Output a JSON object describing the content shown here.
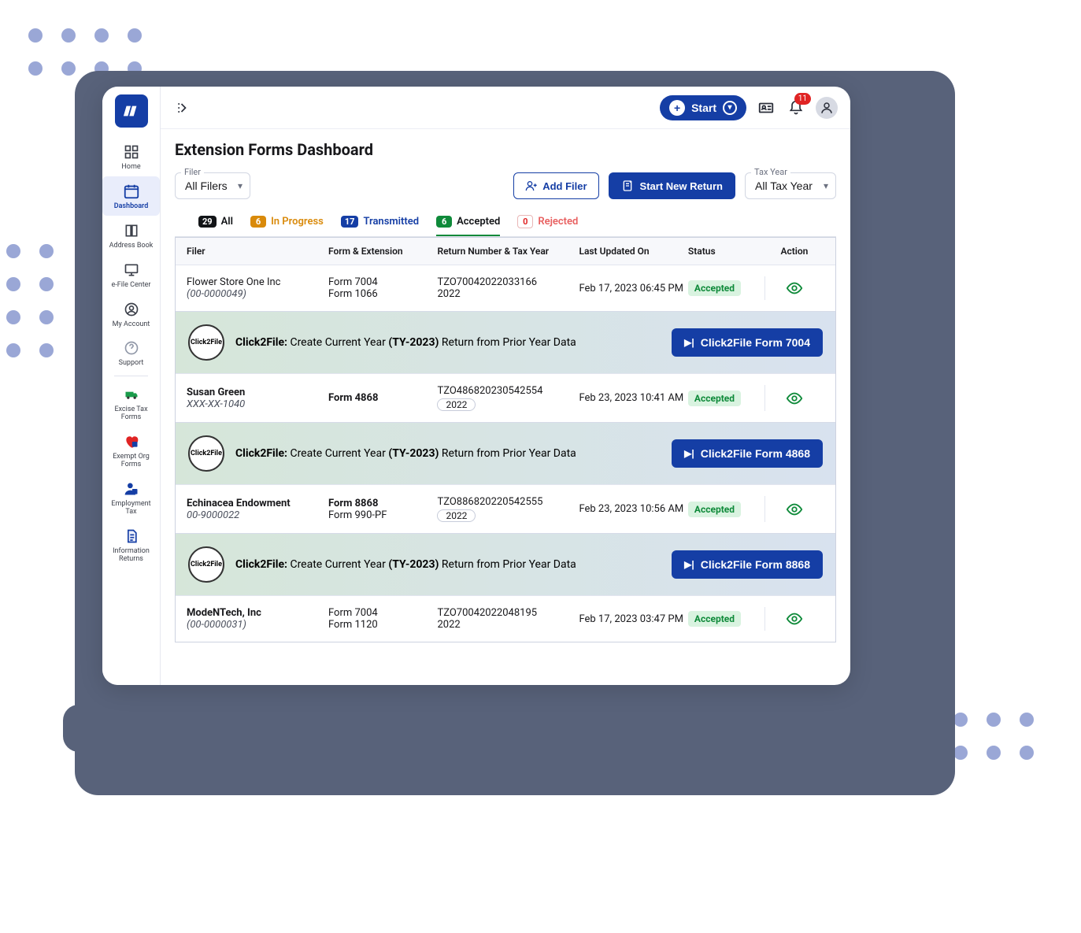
{
  "sidebar": {
    "items": [
      {
        "label": "Home"
      },
      {
        "label": "Dashboard"
      },
      {
        "label": "Address Book"
      },
      {
        "label": "e-File Center"
      },
      {
        "label": "My Account"
      },
      {
        "label": "Support"
      },
      {
        "label": "Excise Tax Forms"
      },
      {
        "label": "Exempt Org Forms"
      },
      {
        "label": "Employment Tax"
      },
      {
        "label": "Information Returns"
      }
    ]
  },
  "topbar": {
    "start_label": "Start",
    "notif_count": "11"
  },
  "page": {
    "title": "Extension Forms Dashboard",
    "filer_label": "Filer",
    "filer_value": "All Filers",
    "add_filer": "Add Filer",
    "start_new": "Start New Return",
    "taxyear_label": "Tax Year",
    "taxyear_value": "All Tax Year"
  },
  "tabs": {
    "all": {
      "count": "29",
      "label": "All"
    },
    "inprogress": {
      "count": "6",
      "label": "In Progress"
    },
    "transmitted": {
      "count": "17",
      "label": "Transmitted"
    },
    "accepted": {
      "count": "6",
      "label": "Accepted"
    },
    "rejected": {
      "count": "0",
      "label": "Rejected"
    }
  },
  "columns": {
    "filer": "Filer",
    "form": "Form & Extension",
    "return": "Return Number & Tax Year",
    "updated": "Last Updated On",
    "status": "Status",
    "action": "Action"
  },
  "click2file": {
    "prefix": "Click2File:",
    "mid1": "Create Current Year",
    "ty": "(TY-2023)",
    "mid2": "Return from Prior Year Data",
    "seal": "Click2File"
  },
  "rows": [
    {
      "name": "Flower Store One Inc",
      "sub": "(00-0000049)",
      "form1": "Form 7004",
      "form2": "Form 1066",
      "ret": "TZO70042022033166",
      "year": "2022",
      "updated": "Feb 17, 2023 06:45 PM",
      "status": "Accepted",
      "c2f_btn": "Click2File Form 7004"
    },
    {
      "name": "Susan Green",
      "sub": "XXX-XX-1040",
      "form1": "Form 4868",
      "form2": "",
      "ret": "TZO486820230542554",
      "year": "2022",
      "updated": "Feb 23, 2023 10:41 AM",
      "status": "Accepted",
      "c2f_btn": "Click2File Form 4868",
      "boldform": true,
      "yearpill": true
    },
    {
      "name": "Echinacea Endowment",
      "sub": "00-9000022",
      "form1": "Form 8868",
      "form2": "Form 990-PF",
      "ret": "TZO886820220542555",
      "year": "2022",
      "updated": "Feb 23, 2023 10:56 AM",
      "status": "Accepted",
      "c2f_btn": "Click2File Form 8868",
      "yearpill": true,
      "boldform": true
    },
    {
      "name": "ModeNTech, Inc",
      "sub": "(00-0000031)",
      "form1": "Form 7004",
      "form2": "Form 1120",
      "ret": "TZO70042022048195",
      "year": "2022",
      "updated": "Feb 17, 2023 03:47 PM",
      "status": "Accepted"
    }
  ]
}
